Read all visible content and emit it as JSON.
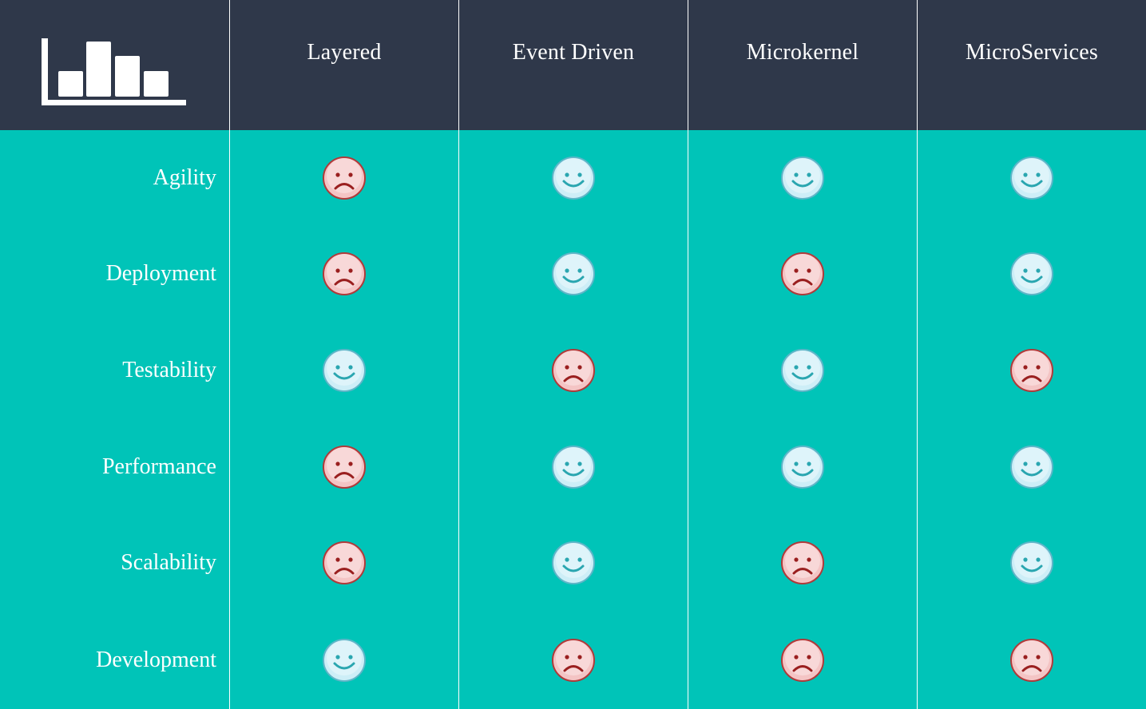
{
  "corner": {
    "icon": "bar-chart-icon"
  },
  "columns": [
    "Layered",
    "Event Driven",
    "Microkernel",
    "MicroServices"
  ],
  "rows": [
    {
      "label": "Agility",
      "ratings": [
        "sad",
        "happy",
        "happy",
        "happy"
      ]
    },
    {
      "label": "Deployment",
      "ratings": [
        "sad",
        "happy",
        "sad",
        "happy"
      ]
    },
    {
      "label": "Testability",
      "ratings": [
        "happy",
        "sad",
        "happy",
        "sad"
      ]
    },
    {
      "label": "Performance",
      "ratings": [
        "sad",
        "happy",
        "happy",
        "happy"
      ]
    },
    {
      "label": "Scalability",
      "ratings": [
        "sad",
        "happy",
        "sad",
        "happy"
      ]
    },
    {
      "label": "Development",
      "ratings": [
        "happy",
        "sad",
        "sad",
        "sad"
      ]
    }
  ],
  "colors": {
    "header_bg": "#2f384a",
    "body_bg": "#00c4b8",
    "happy_face": "#cdeef7",
    "sad_face": "#f4c4c4"
  },
  "icons": {
    "happy": "happy-face-icon",
    "sad": "sad-face-icon"
  }
}
